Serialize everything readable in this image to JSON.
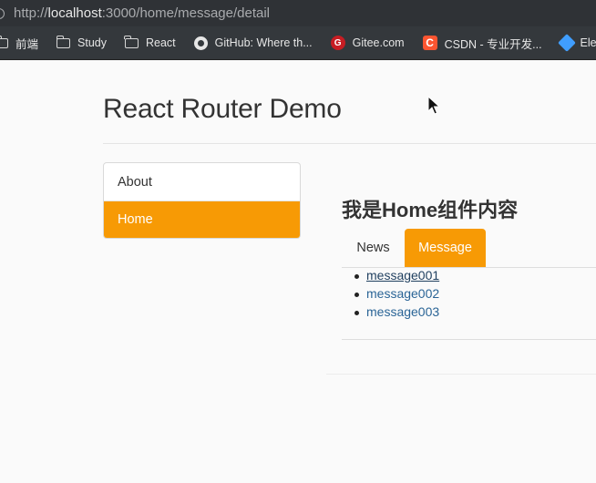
{
  "browser": {
    "url_prefix": "http://",
    "url_host": "localhost",
    "url_rest": ":3000/home/message/detail",
    "bookmarks": [
      {
        "label": "前端",
        "icon": "folder-icon"
      },
      {
        "label": "Study",
        "icon": "folder-icon"
      },
      {
        "label": "React",
        "icon": "folder-icon"
      },
      {
        "label": "GitHub: Where th...",
        "icon": "github-icon"
      },
      {
        "label": "Gitee.com",
        "icon": "gitee-icon",
        "glyph": "G"
      },
      {
        "label": "CSDN - 专业开发...",
        "icon": "csdn-icon",
        "glyph": "C"
      },
      {
        "label": "Eleme",
        "icon": "element-icon"
      }
    ]
  },
  "page": {
    "title": "React Router Demo"
  },
  "nav": {
    "items": [
      {
        "label": "About",
        "active": false
      },
      {
        "label": "Home",
        "active": true
      }
    ]
  },
  "home": {
    "heading": "我是Home组件内容",
    "tabs": [
      {
        "label": "News",
        "active": false
      },
      {
        "label": "Message",
        "active": true
      }
    ],
    "messages": [
      {
        "label": "message001",
        "visited": true
      },
      {
        "label": "message002",
        "visited": false
      },
      {
        "label": "message003",
        "visited": false
      }
    ]
  },
  "colors": {
    "accent": "#f79a05",
    "link": "#2a6496",
    "chrome_bg": "#2f3236"
  }
}
